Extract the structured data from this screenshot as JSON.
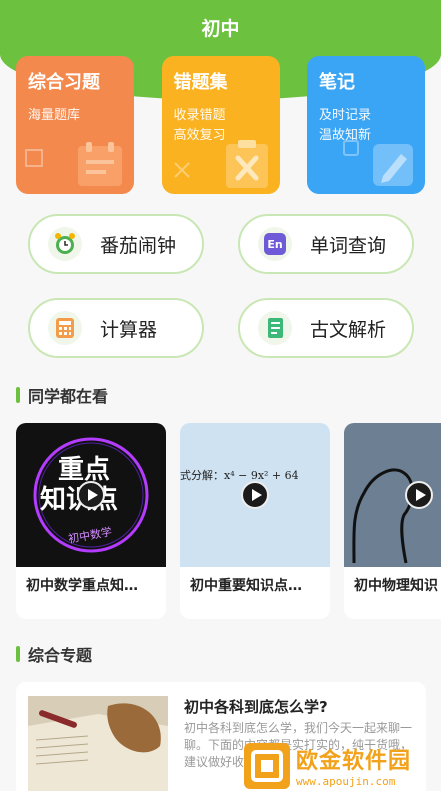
{
  "header": {
    "title": "初中"
  },
  "cards": [
    {
      "title": "综合习题",
      "lines": [
        "海量题库"
      ],
      "color": "#f4894d"
    },
    {
      "title": "错题集",
      "lines": [
        "收录错题",
        "高效复习"
      ],
      "color": "#fbb221"
    },
    {
      "title": "笔记",
      "lines": [
        "及时记录",
        "温故知新"
      ],
      "color": "#3ba5f5"
    }
  ],
  "tools": [
    {
      "label": "番茄闹钟",
      "icon": "alarm-clock-icon"
    },
    {
      "label": "单词查询",
      "icon": "en-dictionary-icon",
      "icon_text": "En"
    },
    {
      "label": "计算器",
      "icon": "calculator-icon"
    },
    {
      "label": "古文解析",
      "icon": "book-icon"
    }
  ],
  "section_watching": {
    "title": "同学都在看"
  },
  "videos": [
    {
      "caption": "初中数学重点知…",
      "thumb_line1": "重点",
      "thumb_line2": "知识点",
      "thumb_tag": "初中数学"
    },
    {
      "caption": "初中重要知识点…",
      "thumb_text": "式分解：x⁴ − 9x² + 64"
    },
    {
      "caption": "初中物理知识"
    }
  ],
  "section_topics": {
    "title": "综合专题"
  },
  "articles": [
    {
      "title": "初中各科到底怎么学?",
      "body": "初中各科到底怎么学，我们今天一起来聊一聊。下面的内容都是实打实的，纯干货哦，建议做好收藏"
    }
  ],
  "watermark": {
    "name": "欧金软件园",
    "url": "www.apoujin.com"
  }
}
